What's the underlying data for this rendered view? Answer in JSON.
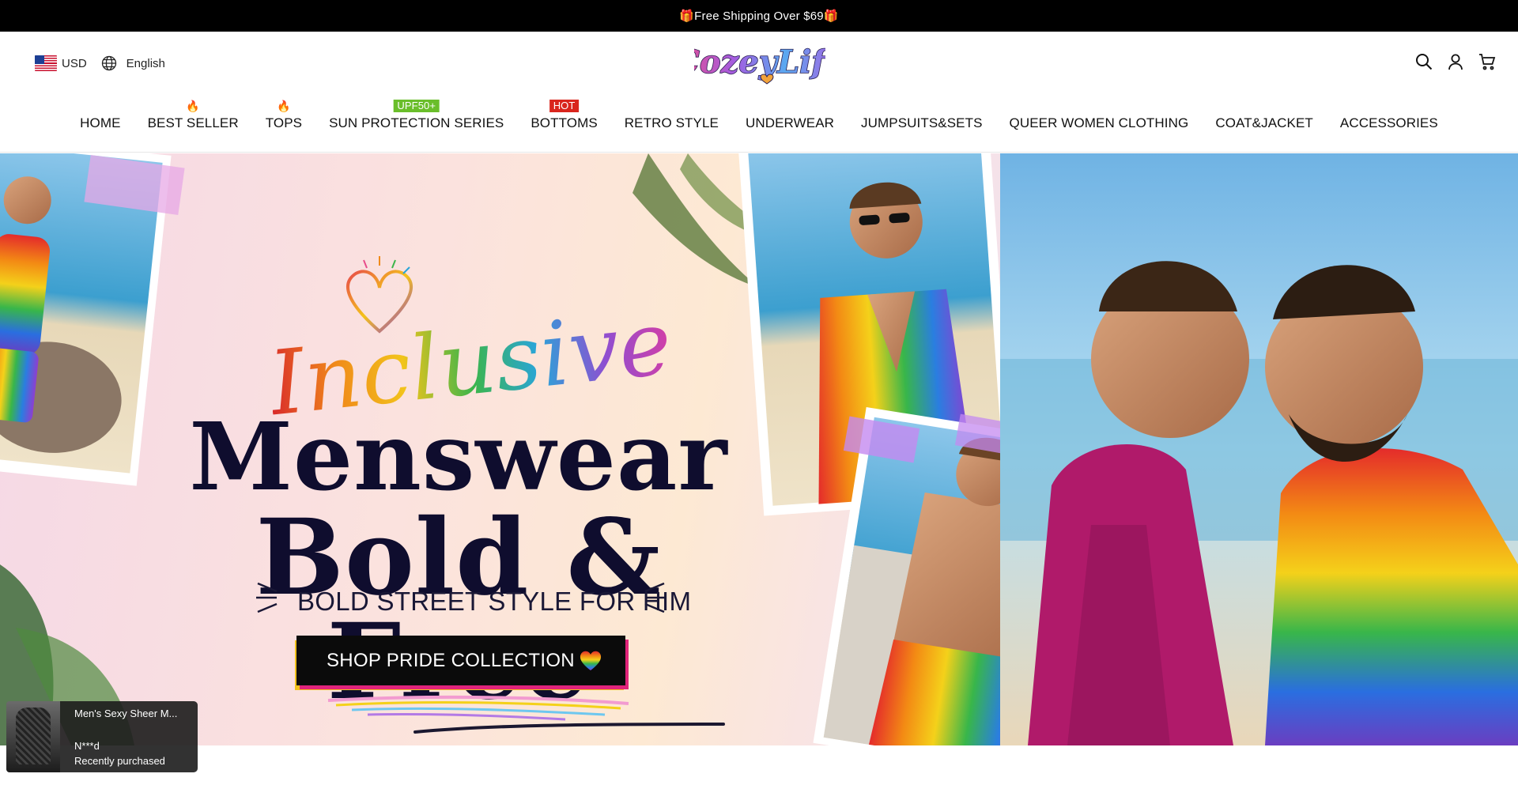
{
  "announcement": {
    "text": "🎁Free Shipping Over $69🎁"
  },
  "header": {
    "currency": "USD",
    "language": "English",
    "logo_text": "CozeyLife",
    "icons": [
      "search-icon",
      "account-icon",
      "cart-icon"
    ]
  },
  "nav": {
    "items": [
      {
        "label": "HOME",
        "badge": ""
      },
      {
        "label": "BEST SELLER",
        "badge": "🔥"
      },
      {
        "label": "TOPS",
        "badge": "🔥"
      },
      {
        "label": "SUN PROTECTION SERIES",
        "badge": "UPF50+"
      },
      {
        "label": "BOTTOMS",
        "badge": "HOT"
      },
      {
        "label": "RETRO STYLE",
        "badge": ""
      },
      {
        "label": "UNDERWEAR",
        "badge": ""
      },
      {
        "label": "JUMPSUITS&SETS",
        "badge": ""
      },
      {
        "label": "QUEER WOMEN CLOTHING",
        "badge": ""
      },
      {
        "label": "COAT&JACKET",
        "badge": ""
      },
      {
        "label": "ACCESSORIES",
        "badge": ""
      }
    ]
  },
  "hero": {
    "script_word": "Inclusive",
    "line1": "Menswear",
    "line2": "Bold & Free",
    "tagline": "BOLD STREET STYLE FOR HIM",
    "cta_label": "SHOP PRIDE COLLECTION"
  },
  "popup": {
    "product": "Men's Sexy Sheer M...",
    "user": "N***d",
    "status": "Recently purchased"
  },
  "colors": {
    "announcement_bg": "#000000",
    "headline": "#0f0d2e",
    "badge_green": "#6abe2a",
    "badge_red": "#d9251c"
  }
}
